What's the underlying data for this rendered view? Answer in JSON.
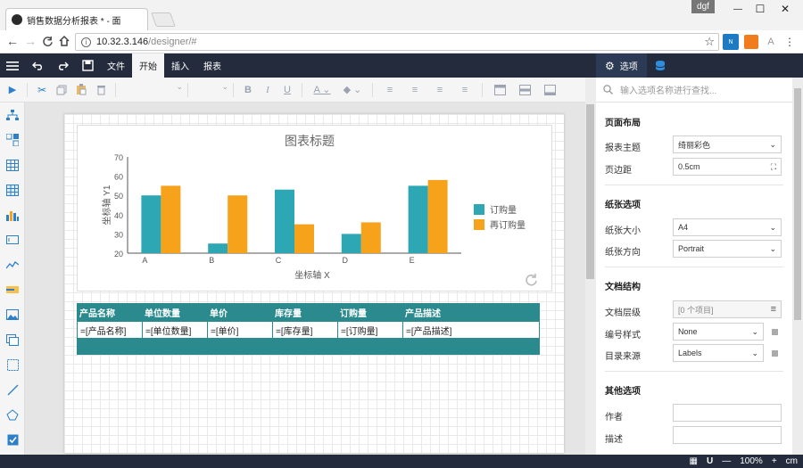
{
  "browser": {
    "tab_title": "销售数据分析报表 * - 面",
    "user": "dgf",
    "url_host": "10.32.3.146",
    "url_path": "/designer/#",
    "win_min": "—",
    "win_max": "☐",
    "win_close": "✕"
  },
  "menu": {
    "file": "文件",
    "start": "开始",
    "insert": "插入",
    "report": "报表"
  },
  "rightbar": {
    "options": "选项"
  },
  "search": {
    "placeholder": "输入选项名称进行查找..."
  },
  "panel": {
    "layout_title": "页面布局",
    "theme_label": "报表主题",
    "theme_value": "绮丽彩色",
    "margin_label": "页边距",
    "margin_value": "0.5cm",
    "paper_title": "纸张选项",
    "size_label": "纸张大小",
    "size_value": "A4",
    "orient_label": "纸张方向",
    "orient_value": "Portrait",
    "doc_title": "文档结构",
    "level_label": "文档层级",
    "level_value": "[0 个项目]",
    "num_label": "编号样式",
    "num_value": "None",
    "toc_label": "目录来源",
    "toc_value": "Labels",
    "other_title": "其他选项",
    "author_label": "作者",
    "desc_label": "描述"
  },
  "table": {
    "headers": [
      "产品名称",
      "单位数量",
      "单价",
      "库存量",
      "订购量",
      "产品描述"
    ],
    "cells": [
      "=[产品名称]",
      "=[单位数量]",
      "=[单价]",
      "=[库存量]",
      "=[订购量]",
      "=[产品描述]"
    ]
  },
  "status": {
    "zoom": "100%",
    "unit": "cm",
    "minus": "—",
    "plus": "+"
  },
  "colors": {
    "series1": "#2ca7b3",
    "series2": "#f7a21b",
    "header": "#2a8a8e",
    "dark": "#232b3d"
  },
  "chart_data": {
    "type": "bar",
    "title": "图表标题",
    "xlabel": "坐标轴 X",
    "ylabel": "坐标轴 Y1",
    "categories": [
      "A",
      "B",
      "C",
      "D",
      "E"
    ],
    "series": [
      {
        "name": "订购量",
        "values": [
          50,
          25,
          53,
          30,
          55
        ]
      },
      {
        "name": "再订购量",
        "values": [
          55,
          50,
          35,
          36,
          58
        ]
      }
    ],
    "ylim": [
      20,
      70
    ],
    "yticks": [
      20,
      30,
      40,
      50,
      60,
      70
    ],
    "legend": "right"
  }
}
